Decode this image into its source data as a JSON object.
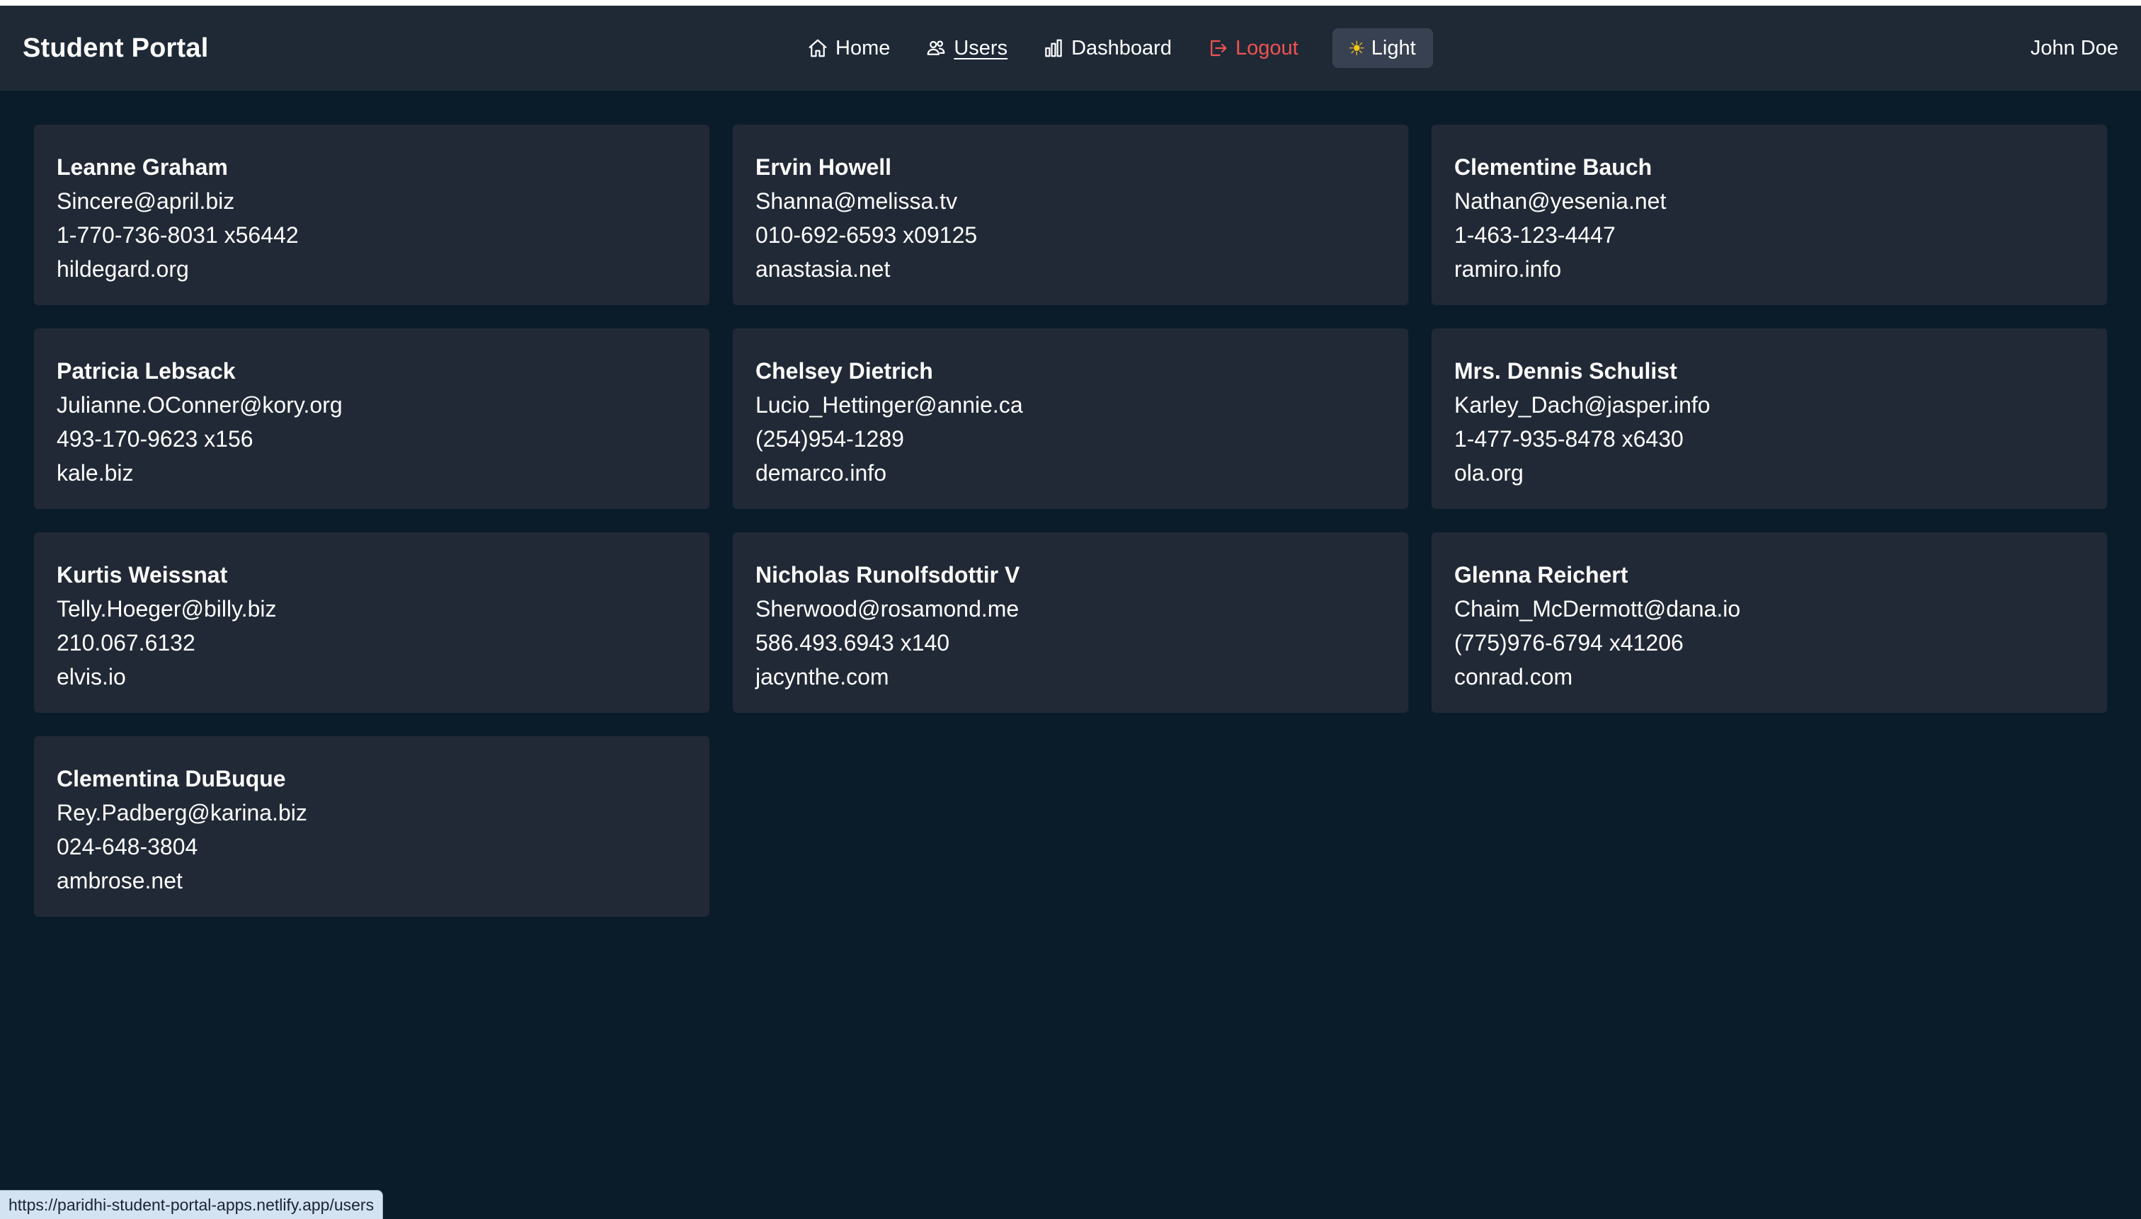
{
  "navbar": {
    "brand": "Student Portal",
    "links": {
      "home": "Home",
      "users": "Users",
      "dashboard": "Dashboard",
      "logout": "Logout"
    },
    "theme_toggle": "Light",
    "user_name": "John Doe"
  },
  "users": [
    {
      "name": "Leanne Graham",
      "email": "Sincere@april.biz",
      "phone": "1-770-736-8031 x56442",
      "website": "hildegard.org"
    },
    {
      "name": "Ervin Howell",
      "email": "Shanna@melissa.tv",
      "phone": "010-692-6593 x09125",
      "website": "anastasia.net"
    },
    {
      "name": "Clementine Bauch",
      "email": "Nathan@yesenia.net",
      "phone": "1-463-123-4447",
      "website": "ramiro.info"
    },
    {
      "name": "Patricia Lebsack",
      "email": "Julianne.OConner@kory.org",
      "phone": "493-170-9623 x156",
      "website": "kale.biz"
    },
    {
      "name": "Chelsey Dietrich",
      "email": "Lucio_Hettinger@annie.ca",
      "phone": "(254)954-1289",
      "website": "demarco.info"
    },
    {
      "name": "Mrs. Dennis Schulist",
      "email": "Karley_Dach@jasper.info",
      "phone": "1-477-935-8478 x6430",
      "website": "ola.org"
    },
    {
      "name": "Kurtis Weissnat",
      "email": "Telly.Hoeger@billy.biz",
      "phone": "210.067.6132",
      "website": "elvis.io"
    },
    {
      "name": "Nicholas Runolfsdottir V",
      "email": "Sherwood@rosamond.me",
      "phone": "586.493.6943 x140",
      "website": "jacynthe.com"
    },
    {
      "name": "Glenna Reichert",
      "email": "Chaim_McDermott@dana.io",
      "phone": "(775)976-6794 x41206",
      "website": "conrad.com"
    },
    {
      "name": "Clementina DuBuque",
      "email": "Rey.Padberg@karina.biz",
      "phone": "024-648-3804",
      "website": "ambrose.net"
    }
  ],
  "status_bar": {
    "url": "https://paridhi-student-portal-apps.netlify.app/users"
  },
  "colors": {
    "background": "#0a1c2a",
    "navbar": "#1f2936",
    "card": "#212936",
    "logout": "#ef5350",
    "toggle": "#374151"
  }
}
